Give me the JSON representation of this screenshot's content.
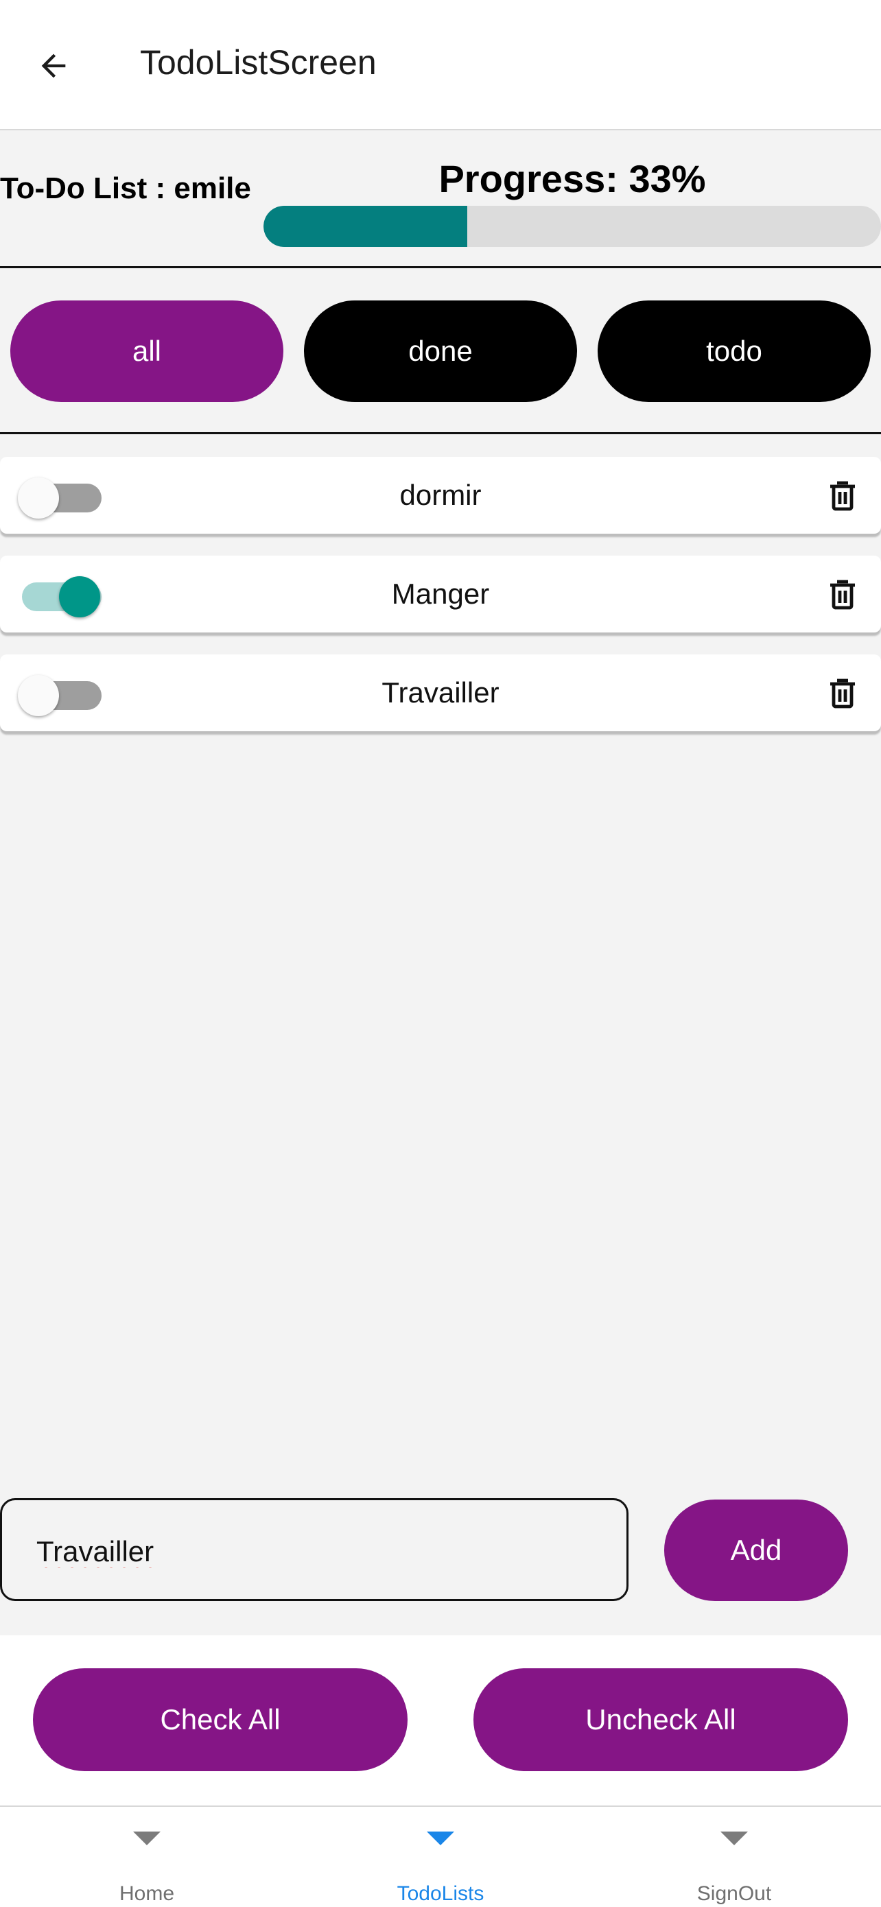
{
  "appbar": {
    "title": "TodoListScreen"
  },
  "header": {
    "list_title": "To-Do List : emile",
    "progress_label": "Progress: 33%",
    "progress_percent": 33
  },
  "filters": [
    {
      "label": "all",
      "active": true
    },
    {
      "label": "done",
      "active": false
    },
    {
      "label": "todo",
      "active": false
    }
  ],
  "todos": [
    {
      "text": "dormir",
      "done": false
    },
    {
      "text": "Manger",
      "done": true
    },
    {
      "text": "Travailler",
      "done": false
    }
  ],
  "new_todo": {
    "value": "Travailler"
  },
  "actions": {
    "add_label": "Add",
    "check_all_label": "Check All",
    "uncheck_all_label": "Uncheck All"
  },
  "nav": [
    {
      "label": "Home",
      "active": false
    },
    {
      "label": "TodoLists",
      "active": true
    },
    {
      "label": "SignOut",
      "active": false
    }
  ],
  "colors": {
    "accent": "#851586",
    "progress": "#047f7f",
    "switch_on": "#009688",
    "nav_active": "#1a86e8"
  }
}
